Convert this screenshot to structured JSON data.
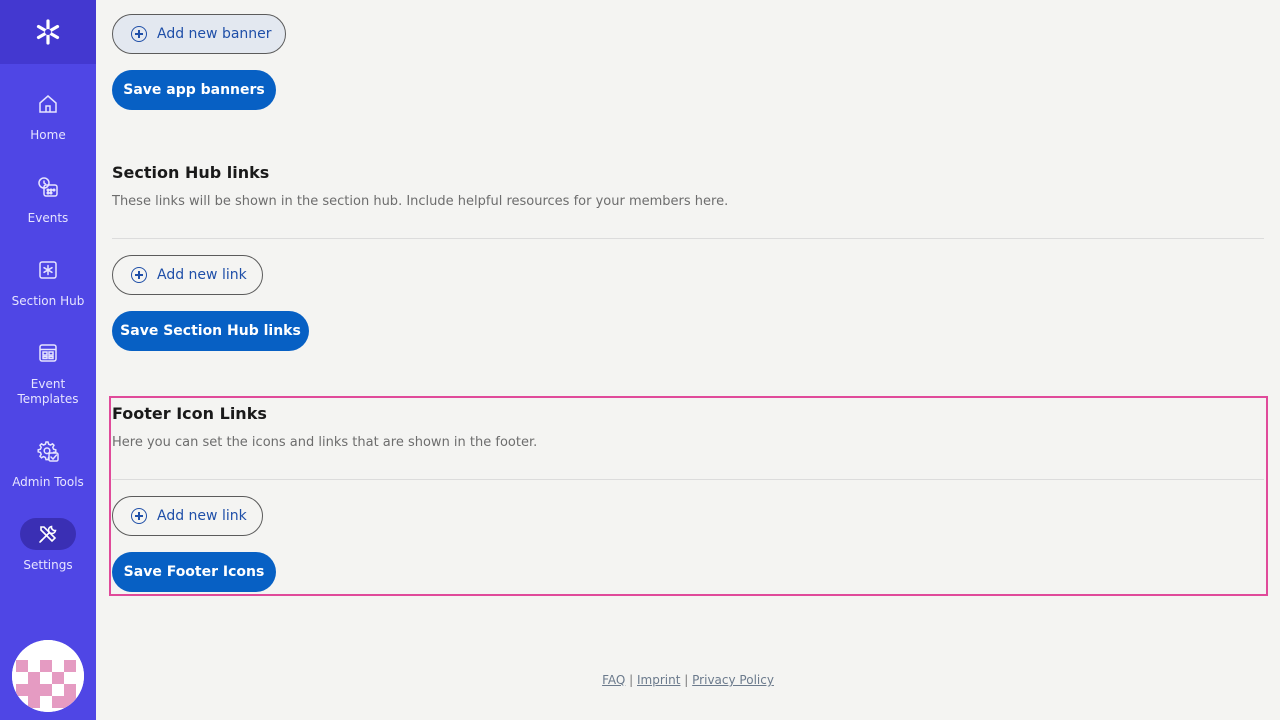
{
  "sidebar": {
    "items": [
      {
        "label": "Home",
        "icon": "home-icon"
      },
      {
        "label": "Events",
        "icon": "events-icon"
      },
      {
        "label": "Section Hub",
        "icon": "section-hub-icon"
      },
      {
        "label": "Event\nTemplates",
        "icon": "templates-icon"
      },
      {
        "label": "Admin Tools",
        "icon": "admin-tools-icon"
      },
      {
        "label": "Settings",
        "icon": "settings-icon",
        "active": true
      }
    ]
  },
  "banners": {
    "add_label": "Add new banner",
    "save_label": "Save app banners"
  },
  "section_hub": {
    "title": "Section Hub links",
    "description": "These links will be shown in the section hub. Include helpful resources for your members here.",
    "add_label": "Add new link",
    "save_label": "Save Section Hub links"
  },
  "footer_icons": {
    "title": "Footer Icon Links",
    "description": "Here you can set the icons and links that are shown in the footer.",
    "add_label": "Add new link",
    "save_label": "Save Footer Icons"
  },
  "footer": {
    "faq": "FAQ",
    "imprint": "Imprint",
    "privacy": "Privacy Policy",
    "separator": "|"
  },
  "colors": {
    "sidebar": "#4f46e5",
    "primary_button": "#0760c4",
    "highlight": "#e04a9a"
  }
}
